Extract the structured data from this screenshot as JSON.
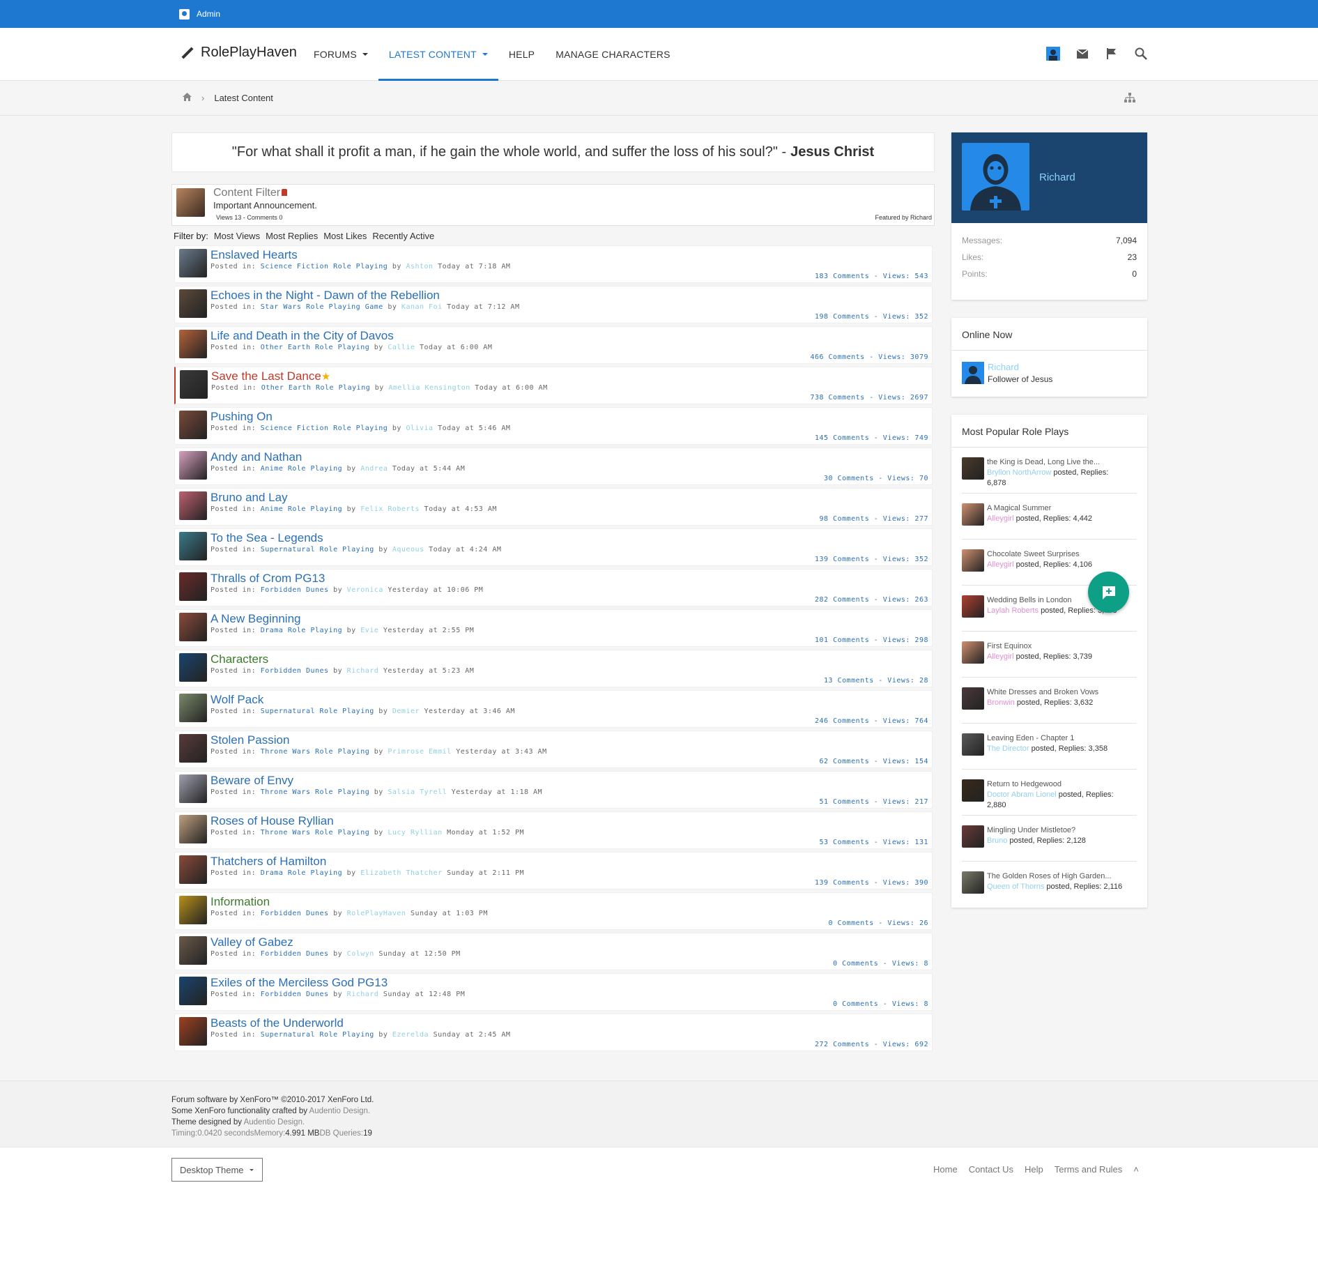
{
  "topbar": {
    "admin_label": "Admin"
  },
  "header": {
    "logo_text": "RolePlayHaven",
    "nav": [
      {
        "label": "FORUMS",
        "caret": true,
        "active": false
      },
      {
        "label": "LATEST CONTENT",
        "caret": true,
        "active": true
      },
      {
        "label": "HELP",
        "caret": false,
        "active": false
      },
      {
        "label": "MANAGE CHARACTERS",
        "caret": false,
        "active": false
      }
    ]
  },
  "breadcrumb": {
    "current": "Latest Content"
  },
  "quote": {
    "text": "\"For what shall it profit a man, if he gain the whole world, and suffer the loss of his soul?\" -",
    "author": "Jesus Christ"
  },
  "content_filter": {
    "title": "Content Filter",
    "subtitle": "Important Announcement.",
    "meta": "Views 13 - Comments 0",
    "featured_by": "Featured by Richard"
  },
  "filter_bar": {
    "label": "Filter by:",
    "options": [
      "Most Views",
      "Most Replies",
      "Most Likes",
      "Recently Active"
    ]
  },
  "threads": [
    {
      "title": "Enslaved Hearts",
      "forum": "Science Fiction Role Playing",
      "user": "Ashton",
      "time": "Today at 7:18 AM",
      "stats": "183 Comments - Views: 543",
      "color": "#6b7b8c"
    },
    {
      "title": "Echoes in the Night - Dawn of the Rebellion",
      "forum": "Star Wars Role Playing Game",
      "user": "Kanan Foi",
      "time": "Today at 7:12 AM",
      "stats": "198 Comments - Views: 352",
      "color": "#5c4a3a"
    },
    {
      "title": "Life and Death in the City of Davos",
      "forum": "Other Earth Role Playing",
      "user": "Callie",
      "time": "Today at 6:00 AM",
      "stats": "466 Comments - Views: 3079",
      "color": "#b5623a"
    },
    {
      "title": "Save the Last Dance",
      "forum": "Other Earth Role Playing",
      "user": "Amellia Kensington",
      "time": "Today at 6:00 AM",
      "stats": "738 Comments - Views: 2697",
      "color": "#3a3a3a",
      "featured": true
    },
    {
      "title": "Pushing On",
      "forum": "Science Fiction Role Playing",
      "user": "Olivia",
      "time": "Today at 5:46 AM",
      "stats": "145 Comments - Views: 749",
      "color": "#7a4a3a"
    },
    {
      "title": "Andy and Nathan",
      "forum": "Anime Role Playing",
      "user": "Andrea",
      "time": "Today at 5:44 AM",
      "stats": "30 Comments - Views: 70",
      "color": "#d7a0c0"
    },
    {
      "title": "Bruno and Lay",
      "forum": "Anime Role Playing",
      "user": "Felix Roberts",
      "time": "Today at 4:53 AM",
      "stats": "98 Comments - Views: 277",
      "color": "#c06070"
    },
    {
      "title": "To the Sea - Legends",
      "forum": "Supernatural Role Playing",
      "user": "Aqueous",
      "time": "Today at 4:24 AM",
      "stats": "139 Comments - Views: 352",
      "color": "#3a7a8a"
    },
    {
      "title": "Thralls of Crom PG13",
      "forum": "Forbidden Dunes",
      "user": "Veronica",
      "time": "Yesterday at 10:06 PM",
      "stats": "282 Comments - Views: 263",
      "color": "#6a2a2a"
    },
    {
      "title": "A New Beginning",
      "forum": "Drama Role Playing",
      "user": "Evie",
      "time": "Yesterday at 2:55 PM",
      "stats": "101 Comments - Views: 298",
      "color": "#8a4a3a"
    },
    {
      "title": "Characters",
      "forum": "Forbidden Dunes",
      "user": "Richard",
      "time": "Yesterday at 5:23 AM",
      "stats": "13 Comments - Views: 28",
      "color": "#1b456e",
      "green": true
    },
    {
      "title": "Wolf Pack",
      "forum": "Supernatural Role Playing",
      "user": "Demier",
      "time": "Yesterday at 3:46 AM",
      "stats": "246 Comments - Views: 764",
      "color": "#7a8a6a"
    },
    {
      "title": "Stolen Passion",
      "forum": "Throne Wars Role Playing",
      "user": "Primrose Emmil",
      "time": "Yesterday at 3:43 AM",
      "stats": "62 Comments - Views: 154",
      "color": "#5a3a3a"
    },
    {
      "title": "Beware of Envy",
      "forum": "Throne Wars Role Playing",
      "user": "Salsia Tyrell",
      "time": "Yesterday at 1:18 AM",
      "stats": "51 Comments - Views: 217",
      "color": "#a0a0b0"
    },
    {
      "title": "Roses of House Ryllian",
      "forum": "Throne Wars Role Playing",
      "user": "Lucy Ryllian",
      "time": "Monday at 1:52 PM",
      "stats": "53 Comments - Views: 131",
      "color": "#c0a080"
    },
    {
      "title": "Thatchers of Hamilton",
      "forum": "Drama Role Playing",
      "user": "Elizabeth Thatcher",
      "time": "Sunday at 2:11 PM",
      "stats": "139 Comments - Views: 390",
      "color": "#8a4a3a"
    },
    {
      "title": "Information",
      "forum": "Forbidden Dunes",
      "user": "RolePlayHaven",
      "time": "Sunday at 1:03 PM",
      "stats": "0 Comments - Views: 26",
      "color": "#b8901a",
      "green": true
    },
    {
      "title": "Valley of Gabez",
      "forum": "Forbidden Dunes",
      "user": "Colwyn",
      "time": "Sunday at 12:50 PM",
      "stats": "0 Comments - Views: 8",
      "color": "#6a5a4a"
    },
    {
      "title": "Exiles of the Merciless God PG13",
      "forum": "Forbidden Dunes",
      "user": "Richard",
      "time": "Sunday at 12:48 PM",
      "stats": "0 Comments - Views: 8",
      "color": "#1b456e"
    },
    {
      "title": "Beasts of the Underworld",
      "forum": "Supernatural Role Playing",
      "user": "Ezerelda",
      "time": "Sunday at 2:45 AM",
      "stats": "272 Comments - Views: 692",
      "color": "#a04020"
    }
  ],
  "meta_labels": {
    "posted_in": "Posted in:",
    "by": "by"
  },
  "profile": {
    "name": "Richard",
    "stats": [
      {
        "label": "Messages:",
        "value": "7,094"
      },
      {
        "label": "Likes:",
        "value": "23"
      },
      {
        "label": "Points:",
        "value": "0"
      }
    ]
  },
  "online_now": {
    "title": "Online Now",
    "user": "Richard",
    "role": "Follower of Jesus"
  },
  "popular": {
    "title": "Most Popular Role Plays",
    "items": [
      {
        "title": "the King is Dead, Long Live the...",
        "user": "Bryllon NorthArrow",
        "detail": "posted, Replies: 6,878",
        "color": "#4a3a2a",
        "blue": true
      },
      {
        "title": "A Magical Summer",
        "user": "Alleygirl",
        "detail": "posted, Replies: 4,442",
        "color": "#d09070"
      },
      {
        "title": "Chocolate Sweet Surprises",
        "user": "Alleygirl",
        "detail": "posted, Replies: 4,106",
        "color": "#d09070"
      },
      {
        "title": "Wedding Bells in London",
        "user": "Laylah Roberts",
        "detail": "posted, Replies: 3,768",
        "color": "#b04030"
      },
      {
        "title": "First Equinox",
        "user": "Alleygirl",
        "detail": "posted, Replies: 3,739",
        "color": "#d09070"
      },
      {
        "title": "White Dresses and Broken Vows",
        "user": "Bronwin",
        "detail": "posted, Replies: 3,632",
        "color": "#4a3a3a"
      },
      {
        "title": "Leaving Eden - Chapter 1",
        "user": "The Director",
        "detail": "posted, Replies: 3,358",
        "color": "#5a5a5a",
        "blue": true
      },
      {
        "title": "Return to Hedgewood",
        "user": "Doctor Abram Lionel",
        "detail": "posted, Replies: 2,880",
        "color": "#3a2a1a",
        "blue": true
      },
      {
        "title": "Mingling Under Mistletoe?",
        "user": "Bruno",
        "detail": "posted, Replies: 2,128",
        "color": "#6a3a3a",
        "blue": true
      },
      {
        "title": "The Golden Roses of High Garden...",
        "user": "Queen of Thorns",
        "detail": "posted, Replies: 2,116",
        "color": "#7a7a6a",
        "blue": true
      }
    ]
  },
  "footer": {
    "line1": "Forum software by XenForo™ ©2010-2017 XenForo Ltd.",
    "line2a": "Some XenForo functionality crafted by",
    "line2b": "Audentio Design.",
    "line3a": "Theme designed by",
    "line3b": "Audentio Design.",
    "timing_label": "Timing:",
    "timing_value": "0.0420 seconds",
    "memory_label": "Memory:",
    "memory_value": "4.991 MB",
    "db_label": "DB Queries:",
    "db_value": "19",
    "theme_button": "Desktop Theme",
    "links": [
      "Home",
      "Contact Us",
      "Help",
      "Terms and Rules"
    ]
  }
}
